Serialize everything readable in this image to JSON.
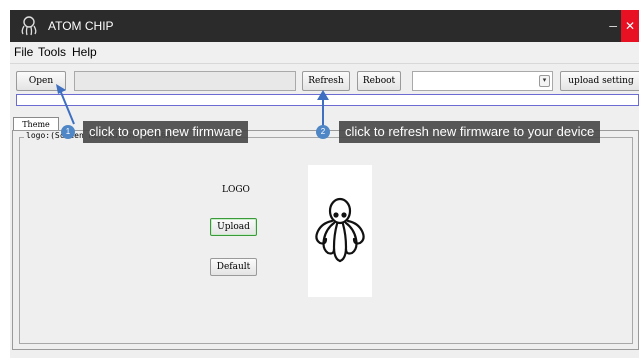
{
  "window": {
    "title": "ATOM CHIP",
    "minimize_glyph": "–",
    "close_glyph": "✕"
  },
  "menu": {
    "items": [
      "File",
      "Tools",
      "Help"
    ]
  },
  "toolbar": {
    "open_label": "Open",
    "refresh_label": "Refresh",
    "reboot_label": "Reboot",
    "upload_setting_label": "upload setting",
    "file_path_value": "",
    "device_select_value": ""
  },
  "progress": {
    "value": 0
  },
  "tabs": [
    {
      "label": "Theme"
    }
  ],
  "logo_group": {
    "legend": "logo:(Screen Resolution 80x160)",
    "logo_label": "LOGO",
    "upload_label": "Upload",
    "default_label": "Default"
  },
  "callouts": [
    {
      "number": "1",
      "text": "click to open new firmware"
    },
    {
      "number": "2",
      "text": "click to refresh new firmware to your device"
    }
  ],
  "icons": {
    "app": "octopus-icon",
    "logo_preview": "octopus-logo",
    "dropdown": "chevron-down-icon"
  },
  "colors": {
    "titlebar": "#2b2b2b",
    "close": "#e81123",
    "callout_bg": "#4a4a4a",
    "badge": "#4f86c6",
    "arrow": "#3f6fc0",
    "progress_border": "#6b6bd1"
  }
}
